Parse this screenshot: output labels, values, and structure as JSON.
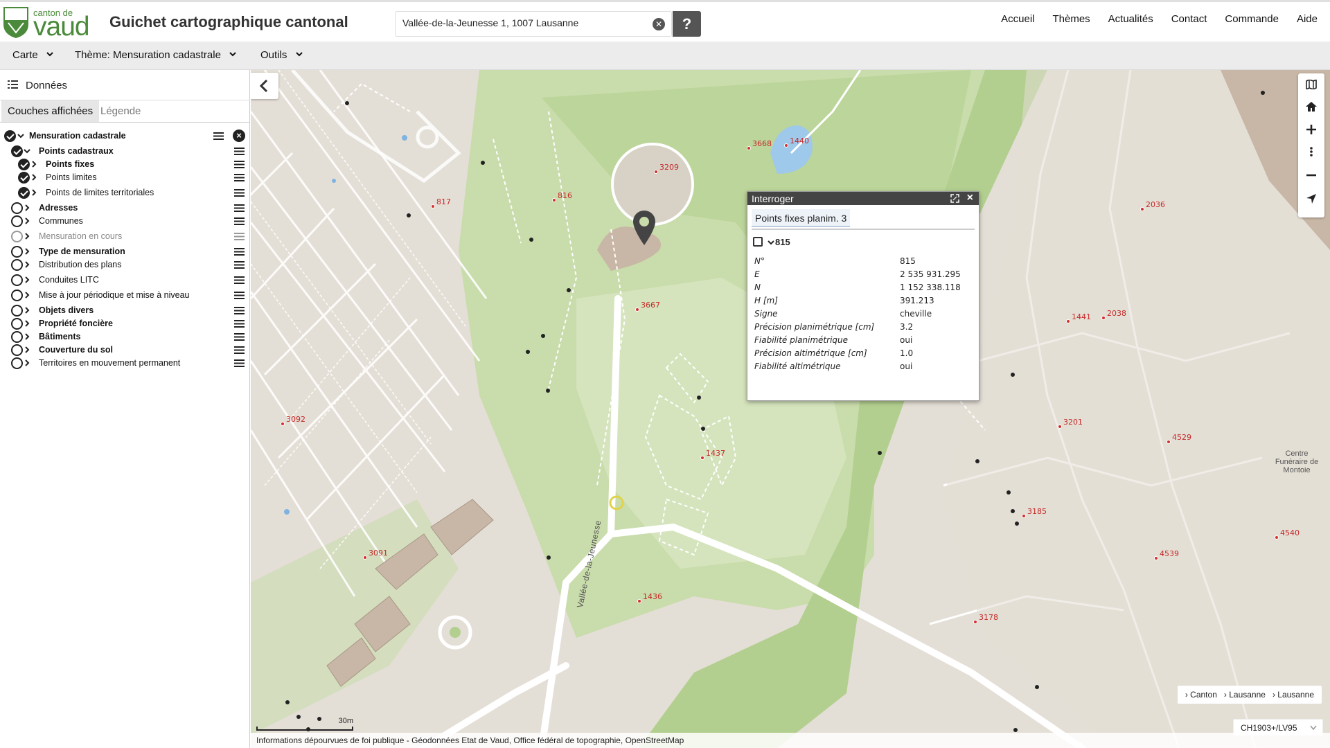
{
  "header": {
    "logo_small": "canton de",
    "logo_big": "vaud",
    "title": "Guichet cartographique cantonal",
    "search_value": "Vallée-de-la-Jeunesse 1, 1007 Lausanne",
    "help_label": "?",
    "nav": [
      "Accueil",
      "Thèmes",
      "Actualités",
      "Contact",
      "Commande",
      "Aide"
    ]
  },
  "menubar": {
    "carte": "Carte",
    "theme": "Thème: Mensuration cadastrale",
    "outils": "Outils"
  },
  "sidebar": {
    "title": "Données",
    "tabs": [
      "Couches affichées",
      "Légende"
    ],
    "layers": [
      {
        "label": "Mensuration cadastrale",
        "checked": true,
        "expanded": true,
        "bold": true,
        "level": 0
      },
      {
        "label": "Points cadastraux",
        "checked": true,
        "expanded": true,
        "bold": true,
        "level": 1
      },
      {
        "label": "Points fixes",
        "checked": true,
        "expanded": false,
        "bold": true,
        "level": 2
      },
      {
        "label": "Points limites",
        "checked": true,
        "expanded": false,
        "bold": false,
        "level": 2
      },
      {
        "label": "Points de limites territoriales",
        "checked": true,
        "expanded": false,
        "bold": false,
        "level": 2
      },
      {
        "label": "Adresses",
        "checked": false,
        "expanded": false,
        "bold": true,
        "level": 1
      },
      {
        "label": "Communes",
        "checked": false,
        "expanded": false,
        "bold": false,
        "level": 1
      },
      {
        "label": "Mensuration en cours",
        "checked": false,
        "expanded": false,
        "bold": false,
        "level": 1,
        "disabled": true
      },
      {
        "label": "Type de mensuration",
        "checked": false,
        "expanded": false,
        "bold": true,
        "level": 1
      },
      {
        "label": "Distribution des plans",
        "checked": false,
        "expanded": false,
        "bold": false,
        "level": 1
      },
      {
        "label": "Conduites LITC",
        "checked": false,
        "expanded": false,
        "bold": false,
        "level": 1
      },
      {
        "label": "Mise à jour périodique et mise à niveau",
        "checked": false,
        "expanded": false,
        "bold": false,
        "level": 1
      },
      {
        "label": "Objets divers",
        "checked": false,
        "expanded": false,
        "bold": true,
        "level": 1
      },
      {
        "label": "Propriété foncière",
        "checked": false,
        "expanded": false,
        "bold": true,
        "level": 1
      },
      {
        "label": "Bâtiments",
        "checked": false,
        "expanded": false,
        "bold": true,
        "level": 1
      },
      {
        "label": "Couverture du sol",
        "checked": false,
        "expanded": false,
        "bold": true,
        "level": 1
      },
      {
        "label": "Territoires en mouvement permanent",
        "checked": false,
        "expanded": false,
        "bold": false,
        "level": 1
      }
    ]
  },
  "popup": {
    "title": "Interroger",
    "layer_tab": "Points fixes planim. 3",
    "feature_id": "815",
    "attributes": [
      {
        "k": "N°",
        "v": "815"
      },
      {
        "k": "E",
        "v": "2 535 931.295"
      },
      {
        "k": "N",
        "v": "1 152 338.118"
      },
      {
        "k": "H [m]",
        "v": "391.213"
      },
      {
        "k": "Signe",
        "v": "cheville"
      },
      {
        "k": "Précision planimétrique [cm]",
        "v": "3.2"
      },
      {
        "k": "Fiabilité planimétrique",
        "v": "oui"
      },
      {
        "k": "Précision altimétrique [cm]",
        "v": "1.0"
      },
      {
        "k": "Fiabilité altimétrique",
        "v": "oui"
      }
    ]
  },
  "map": {
    "point_labels": [
      "3668",
      "1440",
      "3209",
      "817",
      "816",
      "2036",
      "3667",
      "1441",
      "2038",
      "3201",
      "4529",
      "1437",
      "3092",
      "3185",
      "4540",
      "3091",
      "4539",
      "1436",
      "3178"
    ],
    "street_label": "Vallée-de-la-Jeunesse",
    "place_label": "Centre Funéraire de Montoie",
    "breadcrumbs": [
      "Canton",
      "Lausanne",
      "Lausanne"
    ],
    "scale_label": "30m",
    "attribution": "Informations dépourvues de foi publique - Géodonnées Etat de Vaud, Office fédéral de topographie, OpenStreetMap",
    "crs": "CH1903+/LV95",
    "colors": {
      "park": "#c9dcab",
      "park_dark": "#b3cf8f",
      "urban": "#e4dfd6",
      "water": "#9fc9ea",
      "building": "#c8b6a6",
      "road": "#ffffff"
    }
  }
}
